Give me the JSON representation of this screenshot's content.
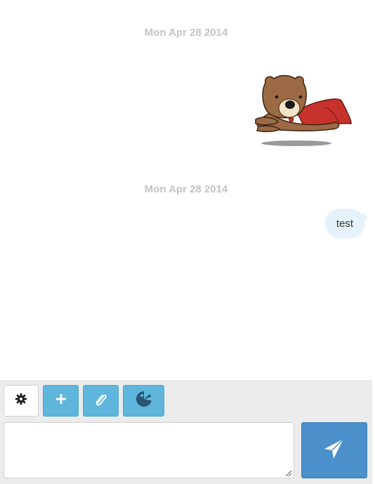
{
  "conversation": {
    "messages": [
      {
        "timestamp": "Mon Apr 28 2014",
        "type": "sticker",
        "sticker_icon": "flying-bear-with-red-cape"
      },
      {
        "timestamp": "Mon Apr 28 2014",
        "type": "text",
        "text": "test"
      }
    ]
  },
  "composer": {
    "tools": [
      {
        "icon": "gear-icon"
      },
      {
        "icon": "plus-icon"
      },
      {
        "icon": "paperclip-icon"
      },
      {
        "icon": "pacman-sticker-icon"
      }
    ],
    "input_value": "",
    "send_icon": "paper-plane-icon"
  },
  "colors": {
    "timestamp": "#c4c4c4",
    "bubble": "#e6f2fb",
    "tool_button": "#5fb6dd",
    "send_button": "#4b8fcb",
    "composer_bg": "#ececec"
  }
}
